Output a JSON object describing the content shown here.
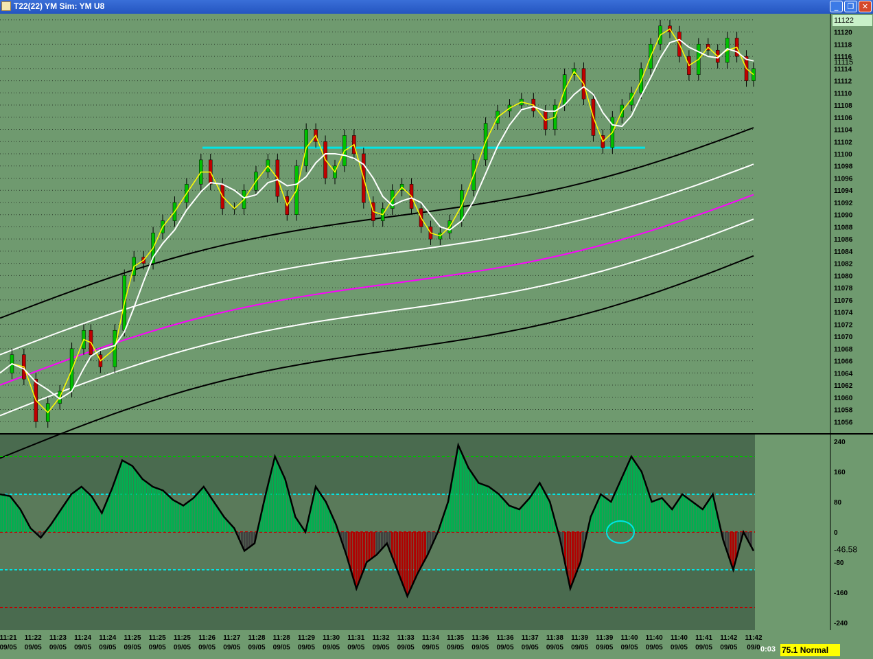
{
  "window": {
    "title": "T22(22) YM Sim: YM U8",
    "buttons": [
      "_",
      "❐",
      "✕"
    ]
  },
  "status": {
    "time_left": "0:03",
    "mode": "75.1 Normal"
  },
  "chart_data": [
    {
      "type": "candlestick",
      "ylim": [
        11054,
        11123
      ],
      "price_ticks": [
        "11122",
        "11120",
        "11118",
        "11116",
        "11114",
        "11112",
        "11110",
        "11108",
        "11106",
        "11104",
        "11102",
        "11100",
        "11098",
        "11096",
        "11094",
        "11092",
        "11090",
        "11088",
        "11086",
        "11084",
        "11082",
        "11080",
        "11078",
        "11076",
        "11074",
        "11072",
        "11070",
        "11068",
        "11066",
        "11064",
        "11062",
        "11060",
        "11058",
        "11056"
      ],
      "current_price": "11122",
      "crosshair_price": "11115",
      "time_labels": [
        "11:21",
        "11:22",
        "11:23",
        "11:24",
        "11:24",
        "11:25",
        "11:25",
        "11:25",
        "11:26",
        "11:27",
        "11:28",
        "11:28",
        "11:29",
        "11:30",
        "11:31",
        "11:32",
        "11:33",
        "11:34",
        "11:35",
        "11:36",
        "11:36",
        "11:37",
        "11:38",
        "11:39",
        "11:39",
        "11:40",
        "11:40",
        "11:40",
        "11:41",
        "11:42",
        "11:42"
      ],
      "date_labels": [
        "09/05",
        "09/05",
        "09/05",
        "09/05",
        "09/05",
        "09/05",
        "09/05",
        "09/05",
        "09/05",
        "09/05",
        "09/05",
        "09/05",
        "09/05",
        "09/05",
        "09/05",
        "09/05",
        "09/05",
        "09/05",
        "09/05",
        "09/05",
        "09/05",
        "09/05",
        "09/05",
        "09/05",
        "09/05",
        "09/05",
        "09/05",
        "09/05",
        "09/05",
        "09/05",
        "09/0"
      ],
      "close_path": [
        [
          0,
          11064
        ],
        [
          5,
          11067
        ],
        [
          10,
          11063
        ],
        [
          15,
          11056
        ],
        [
          20,
          11059
        ],
        [
          25,
          11061
        ],
        [
          30,
          11068
        ],
        [
          35,
          11071
        ],
        [
          38,
          11067
        ],
        [
          42,
          11065
        ],
        [
          48,
          11071
        ],
        [
          52,
          11080
        ],
        [
          56,
          11083
        ],
        [
          60,
          11082
        ],
        [
          64,
          11087
        ],
        [
          68,
          11089
        ],
        [
          73,
          11092
        ],
        [
          78,
          11095
        ],
        [
          84,
          11099
        ],
        [
          88,
          11095
        ],
        [
          93,
          11091
        ],
        [
          98,
          11091
        ],
        [
          102,
          11094
        ],
        [
          107,
          11097
        ],
        [
          112,
          11099
        ],
        [
          116,
          11093
        ],
        [
          120,
          11090
        ],
        [
          124,
          11098
        ],
        [
          128,
          11104
        ],
        [
          132,
          11102
        ],
        [
          136,
          11096
        ],
        [
          140,
          11098
        ],
        [
          144,
          11103
        ],
        [
          148,
          11100
        ],
        [
          152,
          11092
        ],
        [
          156,
          11089
        ],
        [
          160,
          11091
        ],
        [
          164,
          11094
        ],
        [
          168,
          11095
        ],
        [
          172,
          11091
        ],
        [
          176,
          11088
        ],
        [
          180,
          11086
        ],
        [
          184,
          11087
        ],
        [
          188,
          11089
        ],
        [
          193,
          11094
        ],
        [
          198,
          11099
        ],
        [
          203,
          11105
        ],
        [
          208,
          11107
        ],
        [
          213,
          11108
        ],
        [
          218,
          11109
        ],
        [
          223,
          11107
        ],
        [
          228,
          11104
        ],
        [
          232,
          11108
        ],
        [
          236,
          11113
        ],
        [
          240,
          11114
        ],
        [
          244,
          11109
        ],
        [
          248,
          11103
        ],
        [
          252,
          11101
        ],
        [
          256,
          11106
        ],
        [
          260,
          11108
        ],
        [
          264,
          11110
        ],
        [
          268,
          11114
        ],
        [
          272,
          11118
        ],
        [
          276,
          11121
        ],
        [
          280,
          11120
        ],
        [
          284,
          11116
        ],
        [
          288,
          11113
        ],
        [
          292,
          11118
        ],
        [
          296,
          11117
        ],
        [
          300,
          11115
        ],
        [
          304,
          11119
        ],
        [
          308,
          11116
        ],
        [
          312,
          11112
        ],
        [
          315,
          11114
        ]
      ],
      "series": [
        {
          "name": "",
          "color": "#ffff00",
          "values": "fast"
        },
        {
          "name": "",
          "color": "#ffffff",
          "values": "slow"
        }
      ],
      "bands": [
        {
          "color": "#000000",
          "from": 11073,
          "to": 11105
        },
        {
          "color": "#ffffff",
          "from": 11067,
          "to": 11099
        },
        {
          "color": "#ff00ff",
          "from": 11062,
          "to": 11094
        },
        {
          "color": "#ffffff",
          "from": 11057,
          "to": 11090
        },
        {
          "color": "#000000",
          "from": 11050,
          "to": 11084
        }
      ],
      "resistance_line": {
        "price": 11101,
        "color": "#00e5e5"
      }
    },
    {
      "type": "histogram",
      "ylim": [
        -260,
        260
      ],
      "ticks": [
        "240",
        "160",
        "80",
        "0",
        "-80",
        "-160",
        "-240"
      ],
      "current_value": "-46.58",
      "levels": [
        200,
        100,
        0,
        -100,
        -200
      ],
      "values": [
        100,
        95,
        60,
        10,
        -15,
        20,
        60,
        100,
        120,
        95,
        50,
        115,
        190,
        175,
        140,
        120,
        110,
        85,
        70,
        90,
        120,
        80,
        40,
        10,
        -50,
        -30,
        90,
        200,
        140,
        40,
        0,
        120,
        80,
        20,
        -60,
        -150,
        -80,
        -60,
        -30,
        -100,
        -170,
        -110,
        -60,
        0,
        80,
        230,
        170,
        130,
        120,
        100,
        70,
        60,
        90,
        130,
        80,
        -20,
        -150,
        -80,
        40,
        100,
        80,
        140,
        200,
        160,
        80,
        90,
        60,
        100,
        80,
        60,
        100,
        -20,
        -100,
        0,
        -50
      ],
      "colors": {
        "positive": "#00b050",
        "negative": "#b00000",
        "neutral": "#404040",
        "zero_cross": "#ffff00"
      }
    }
  ]
}
